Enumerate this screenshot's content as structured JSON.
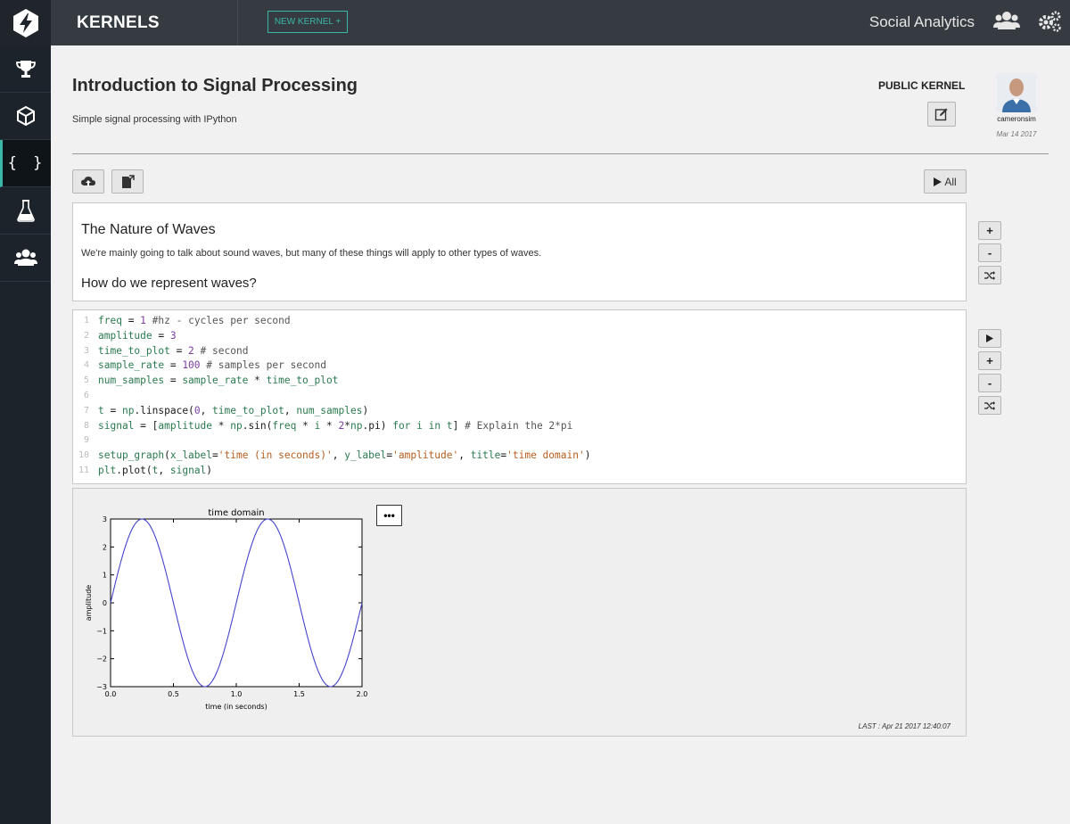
{
  "topbar": {
    "section_title": "KERNELS",
    "new_kernel_label": "NEW KERNEL +",
    "org_name": "Social Analytics"
  },
  "sidebar": {
    "items": [
      {
        "name": "trophy-icon"
      },
      {
        "name": "cube-icon"
      },
      {
        "name": "braces-icon",
        "label": "{ }",
        "active": true
      },
      {
        "name": "flask-icon"
      },
      {
        "name": "users-icon"
      }
    ]
  },
  "kernel": {
    "title": "Introduction to Signal Processing",
    "subtitle": "Simple signal processing with IPython",
    "visibility": "PUBLIC KERNEL",
    "author": "cameronsim",
    "date": "Mar 14 2017"
  },
  "toolbar": {
    "run_all_label": "All"
  },
  "markdown_cell": {
    "heading": "The Nature of Waves",
    "paragraph": "We're mainly going to talk about sound waves, but many of these things will apply to other types of waves.",
    "subheading": "How do we represent waves?"
  },
  "code_cell": {
    "lines": [
      {
        "n": "1",
        "text": "freq = 1 #hz - cycles per second"
      },
      {
        "n": "2",
        "text": "amplitude = 3"
      },
      {
        "n": "3",
        "text": "time_to_plot = 2 # second"
      },
      {
        "n": "4",
        "text": "sample_rate = 100 # samples per second"
      },
      {
        "n": "5",
        "text": "num_samples = sample_rate * time_to_plot"
      },
      {
        "n": "6",
        "text": ""
      },
      {
        "n": "7",
        "text": "t = np.linspace(0, time_to_plot, num_samples)"
      },
      {
        "n": "8",
        "text": "signal = [amplitude * np.sin(freq * i * 2*np.pi) for i in t] # Explain the 2*pi"
      },
      {
        "n": "9",
        "text": ""
      },
      {
        "n": "10",
        "text": "setup_graph(x_label='time (in seconds)', y_label='amplitude', title='time domain')"
      },
      {
        "n": "11",
        "text": "plt.plot(t, signal)"
      }
    ]
  },
  "output_cell": {
    "more_label": "•••",
    "last_run": "LAST : Apr 21 2017 12:40:07"
  },
  "colors": {
    "accent": "#3bb7a7",
    "line": "#4444cc"
  },
  "chart_data": {
    "type": "line",
    "title": "time domain",
    "xlabel": "time (in seconds)",
    "ylabel": "amplitude",
    "xlim": [
      0.0,
      2.0
    ],
    "ylim": [
      -3,
      3
    ],
    "xticks": [
      "0.0",
      "0.5",
      "1.0",
      "1.5",
      "2.0"
    ],
    "yticks": [
      "3",
      "2",
      "1",
      "0",
      "−1",
      "−2",
      "−3"
    ],
    "series": [
      {
        "amplitude": 3,
        "frequency_hz": 1,
        "x_start": 0,
        "x_end": 2,
        "samples": 200
      }
    ]
  }
}
